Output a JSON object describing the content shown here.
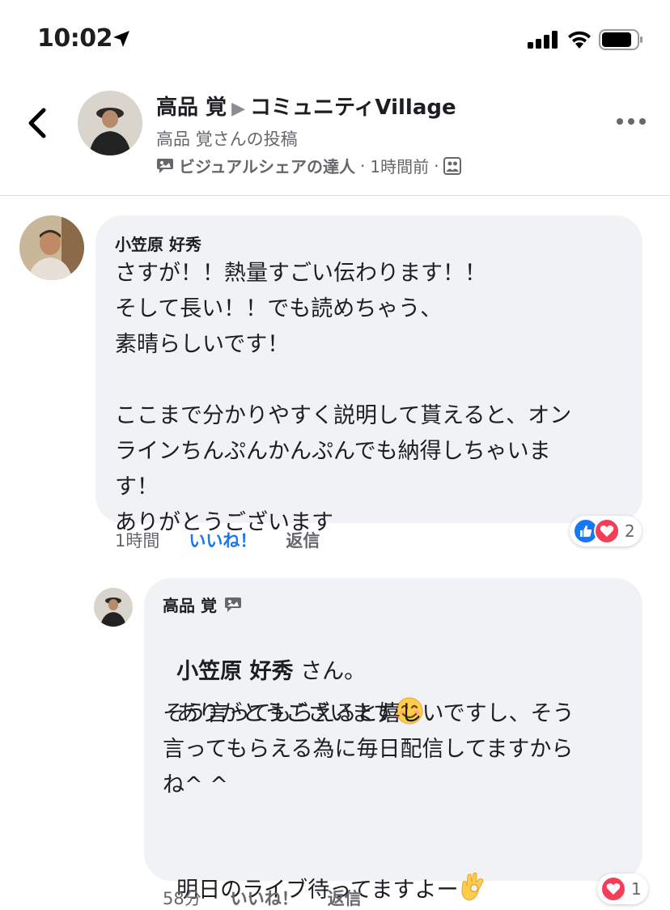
{
  "status_bar": {
    "time": "10:02"
  },
  "header": {
    "author": "高品 覚",
    "group": "コミュニティVillage",
    "subtitle": "高品 覚さんの投稿",
    "badge": "ビジュアルシェアの達人",
    "time": "1時間前",
    "dot": "·"
  },
  "comments": [
    {
      "author": "小笠原 好秀",
      "text": "さすが！！熱量すごい伝わります！！\nそして長い！！でも読めちゃう、\n素晴らしいです！\n\nここまで分かりやすく説明して貰えると、オン\nラインちんぷんかんぷんでも納得しちゃいま\nす！\nありがとうございます",
      "time": "1時間",
      "like_label": "いいね！",
      "reply_label": "返信",
      "reaction_count": "2"
    },
    {
      "author": "高品 覚",
      "mention": "小笠原 好秀",
      "mention_suffix": " さん。",
      "line1": "ありがとうございます",
      "text": "そう言ってもらえると嬉しいですし、そう\n言ってもらえる為に毎日配信してますから\nね^ ^\n\n",
      "last_line": "明日のライブ待ってますよー",
      "time": "58分",
      "like_label": "いいね！",
      "reply_label": "返信",
      "reaction_count": "1"
    }
  ],
  "colors": {
    "like_blue": "#1877f2",
    "love_red": "#f33e58",
    "bubble": "#f0f2f5",
    "secondary": "#65676b"
  }
}
